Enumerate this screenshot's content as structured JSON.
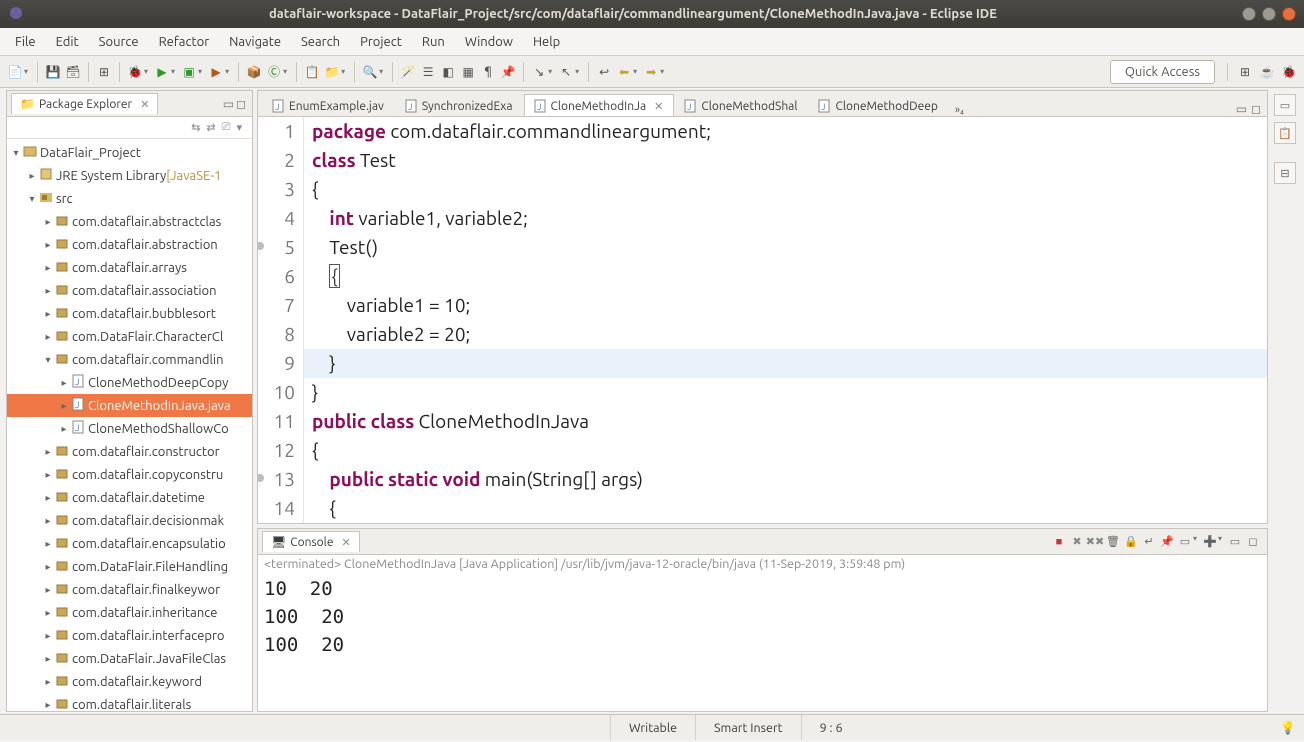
{
  "window": {
    "title": "dataflair-workspace - DataFlair_Project/src/com/dataflair/commandlineargument/CloneMethodInJava.java - Eclipse IDE"
  },
  "menu": [
    "File",
    "Edit",
    "Source",
    "Refactor",
    "Navigate",
    "Search",
    "Project",
    "Run",
    "Window",
    "Help"
  ],
  "quick_access_placeholder": "Quick Access",
  "package_explorer": {
    "title": "Package Explorer",
    "project": "DataFlair_Project",
    "jre": "JRE System Library",
    "jre_deco": "[JavaSE-1",
    "src": "src",
    "packages": [
      "com.dataflair.abstractclas",
      "com.dataflair.abstraction",
      "com.dataflair.arrays",
      "com.dataflair.association",
      "com.dataflair.bubblesort",
      "com.DataFlair.CharacterCl",
      "com.dataflair.commandlin"
    ],
    "commandline_children": [
      "CloneMethodDeepCopy",
      "CloneMethodInJava.java",
      "CloneMethodShallowCo"
    ],
    "packages_after": [
      "com.dataflair.constructor",
      "com.dataflair.copyconstru",
      "com.dataflair.datetime",
      "com.dataflair.decisionmak",
      "com.dataflair.encapsulatio",
      "com.DataFlair.FileHandling",
      "com.dataflair.finalkeywor",
      "com.dataflair.inheritance",
      "com.dataflair.interfacepro",
      "com.DataFlair.JavaFileClas",
      "com.dataflair.keyword",
      "com.dataflair.literals"
    ]
  },
  "editor": {
    "tabs": [
      {
        "label": "EnumExample.jav",
        "active": false
      },
      {
        "label": "SynchronizedExa",
        "active": false
      },
      {
        "label": "CloneMethodInJa",
        "active": true
      },
      {
        "label": "CloneMethodShal",
        "active": false
      },
      {
        "label": "CloneMethodDeep",
        "active": false
      }
    ],
    "more_tabs": "»₄",
    "code_lines": [
      {
        "n": 1,
        "seg": [
          [
            "kw",
            "package"
          ],
          [
            "nrm",
            " com.dataflair.commandlineargument;"
          ]
        ]
      },
      {
        "n": 2,
        "seg": [
          [
            "kw",
            "class"
          ],
          [
            "nrm",
            " Test"
          ]
        ]
      },
      {
        "n": 3,
        "seg": [
          [
            "nrm",
            "{"
          ]
        ]
      },
      {
        "n": 4,
        "seg": [
          [
            "nrm",
            "    "
          ],
          [
            "kw",
            "int"
          ],
          [
            "nrm",
            " variable1, variable2;"
          ]
        ]
      },
      {
        "n": 5,
        "ann": true,
        "seg": [
          [
            "nrm",
            "    Test()"
          ]
        ]
      },
      {
        "n": 6,
        "seg": [
          [
            "nrm",
            "    "
          ],
          [
            "box",
            "{"
          ]
        ]
      },
      {
        "n": 7,
        "seg": [
          [
            "nrm",
            "        variable1 = 10;"
          ]
        ]
      },
      {
        "n": 8,
        "seg": [
          [
            "nrm",
            "        variable2 = 20;"
          ]
        ]
      },
      {
        "n": 9,
        "hl": true,
        "seg": [
          [
            "nrm",
            "    }"
          ]
        ]
      },
      {
        "n": 10,
        "seg": [
          [
            "nrm",
            "}"
          ]
        ]
      },
      {
        "n": 11,
        "seg": [
          [
            "kw",
            "public"
          ],
          [
            "nrm",
            " "
          ],
          [
            "kw",
            "class"
          ],
          [
            "nrm",
            " CloneMethodInJava"
          ]
        ]
      },
      {
        "n": 12,
        "seg": [
          [
            "nrm",
            "{"
          ]
        ]
      },
      {
        "n": 13,
        "ann": true,
        "seg": [
          [
            "nrm",
            "    "
          ],
          [
            "kw",
            "public"
          ],
          [
            "nrm",
            " "
          ],
          [
            "kw",
            "static"
          ],
          [
            "nrm",
            " "
          ],
          [
            "kw",
            "void"
          ],
          [
            "nrm",
            " main(String[] args)"
          ]
        ]
      },
      {
        "n": 14,
        "seg": [
          [
            "nrm",
            "    {"
          ]
        ]
      }
    ]
  },
  "console": {
    "title": "Console",
    "status_prefix": "<terminated>",
    "status_rest": " CloneMethodInJava [Java Application] /usr/lib/jvm/java-12-oracle/bin/java (11-Sep-2019, 3:59:48 pm)",
    "output": "10  20\n100  20\n100  20"
  },
  "statusbar": {
    "writable": "Writable",
    "insert": "Smart Insert",
    "pos": "9 : 6"
  }
}
